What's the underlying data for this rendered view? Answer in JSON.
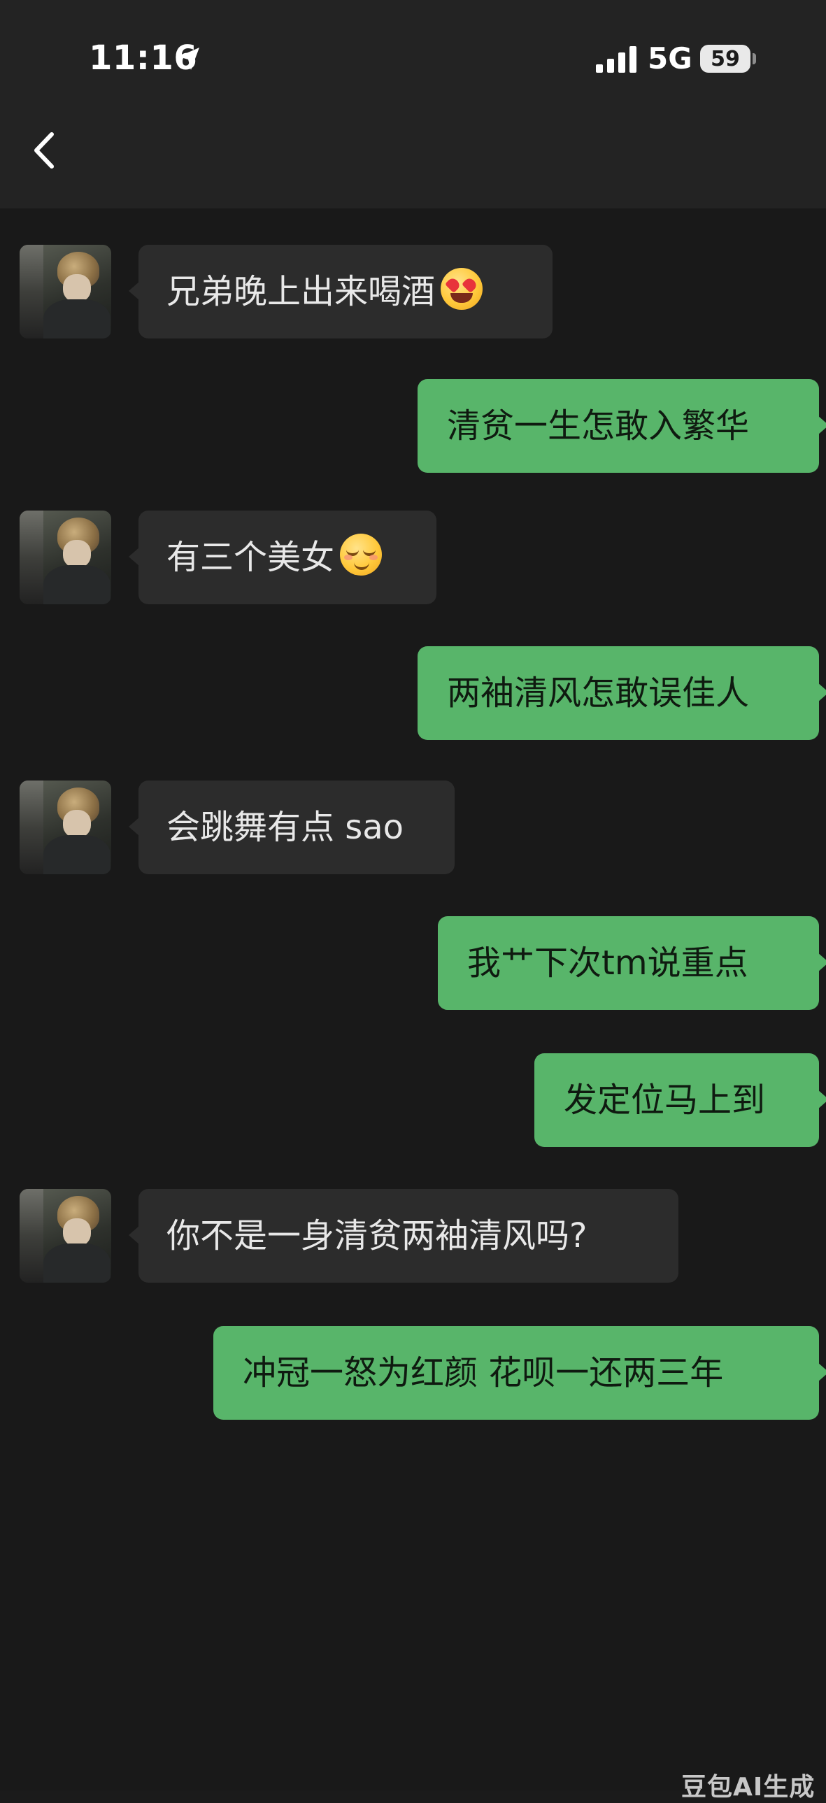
{
  "status_bar": {
    "time": "11:16",
    "network": "5G",
    "battery": "59"
  },
  "nav": {
    "back_icon": "chevron-left-icon"
  },
  "messages": [
    {
      "side": "in",
      "text": "兄弟晚上出来喝酒",
      "emoji": "heart-eyes-emoji"
    },
    {
      "side": "out",
      "text": "清贫一生怎敢入繁华"
    },
    {
      "side": "in",
      "text": "有三个美女",
      "emoji": "smirking-blush-emoji"
    },
    {
      "side": "out",
      "text": "两袖清风怎敢误佳人"
    },
    {
      "side": "in",
      "text": "会跳舞有点 sao"
    },
    {
      "side": "out",
      "text": "我艹下次tm说重点"
    },
    {
      "side": "out",
      "text": "发定位马上到"
    },
    {
      "side": "in",
      "text": "你不是一身清贫两袖清风吗?"
    },
    {
      "side": "out",
      "text": "冲冠一怒为红颜 花呗一还两三年"
    }
  ],
  "watermark": "豆包AI生成",
  "colors": {
    "background": "#191919",
    "incoming_bubble": "#2c2c2c",
    "outgoing_bubble": "#58b56a"
  }
}
